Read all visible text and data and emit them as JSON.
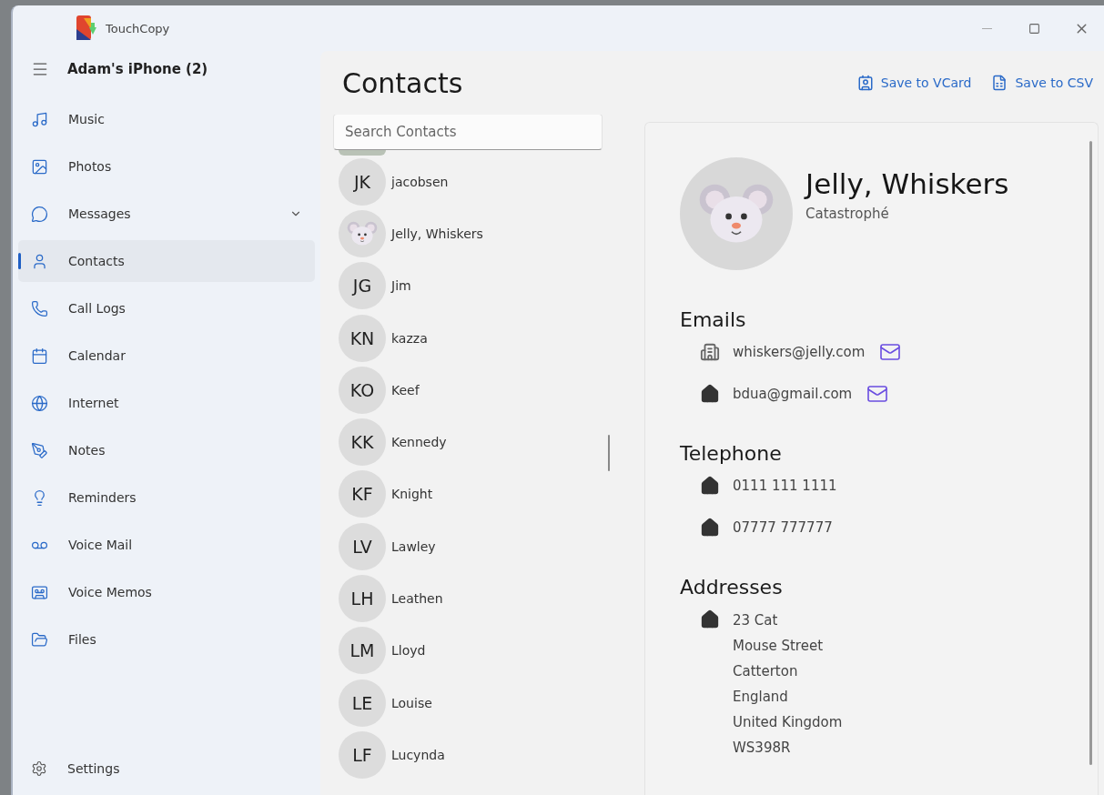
{
  "window": {
    "title": "TouchCopy"
  },
  "sidebar": {
    "device": "Adam's iPhone (2)",
    "items": [
      {
        "label": "Music",
        "selected": false
      },
      {
        "label": "Photos",
        "selected": false
      },
      {
        "label": "Messages",
        "selected": false,
        "expanded": false
      },
      {
        "label": "Contacts",
        "selected": true
      },
      {
        "label": "Call Logs",
        "selected": false
      },
      {
        "label": "Calendar",
        "selected": false
      },
      {
        "label": "Internet",
        "selected": false
      },
      {
        "label": "Notes",
        "selected": false
      },
      {
        "label": "Reminders",
        "selected": false
      },
      {
        "label": "Voice Mail",
        "selected": false
      },
      {
        "label": "Voice Memos",
        "selected": false
      },
      {
        "label": "Files",
        "selected": false
      }
    ],
    "settings": "Settings"
  },
  "page": {
    "title": "Contacts",
    "actions": [
      "Save to VCard",
      "Save to CSV"
    ]
  },
  "search": {
    "placeholder": "Search Contacts"
  },
  "contacts": [
    {
      "kind": "initials",
      "initials": "JK",
      "name": "jacobsen",
      "selected": false
    },
    {
      "kind": "photo",
      "name": "Jelly, Whiskers",
      "selected": false
    },
    {
      "kind": "initials",
      "initials": "JG",
      "name": "Jim",
      "selected": false
    },
    {
      "kind": "initials",
      "initials": "KN",
      "name": "kazza",
      "selected": false
    },
    {
      "kind": "initials",
      "initials": "KO",
      "name": "Keef",
      "selected": false
    },
    {
      "kind": "initials",
      "initials": "KK",
      "name": "Kennedy",
      "selected": false
    },
    {
      "kind": "initials",
      "initials": "KF",
      "name": "Knight",
      "selected": false
    },
    {
      "kind": "initials",
      "initials": "LV",
      "name": "Lawley",
      "selected": false
    },
    {
      "kind": "initials",
      "initials": "LH",
      "name": "Leathen",
      "selected": false
    },
    {
      "kind": "initials",
      "initials": "LM",
      "name": "Lloyd",
      "selected": false
    },
    {
      "kind": "initials",
      "initials": "LE",
      "name": "Louise",
      "selected": false
    },
    {
      "kind": "initials",
      "initials": "LF",
      "name": "Lucynda",
      "selected": false
    }
  ],
  "detail": {
    "name": "Jelly, Whiskers",
    "company": "Catastrophé",
    "emails": {
      "heading": "Emails",
      "items": [
        {
          "kind": "work",
          "value": "whiskers@jelly.com"
        },
        {
          "kind": "home",
          "value": "bdua@gmail.com"
        }
      ]
    },
    "telephone": {
      "heading": "Telephone",
      "items": [
        {
          "kind": "home",
          "value": "0111 111 1111"
        },
        {
          "kind": "home",
          "value": "07777 777777"
        }
      ]
    },
    "addresses": {
      "heading": "Addresses",
      "items": [
        {
          "kind": "home",
          "lines": [
            "23 Cat",
            "Mouse Street",
            "Catterton",
            "England",
            "United Kingdom",
            "WS398R"
          ]
        }
      ]
    }
  }
}
